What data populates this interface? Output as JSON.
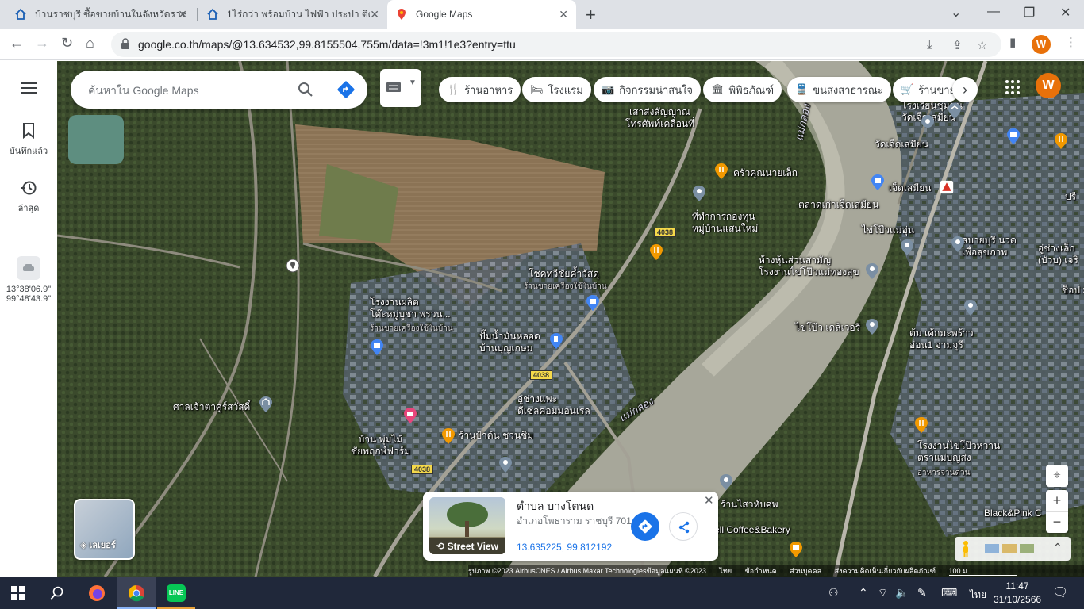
{
  "browser": {
    "tabs": [
      {
        "title": "บ้านราชบุรี ซื้อขายบ้านในจังหวัดราชบุรี",
        "active": false
      },
      {
        "title": "1ไร่กว่า พร้อมบ้าน ไฟฟ้า ประปา ติดถนน",
        "active": false
      },
      {
        "title": "Google Maps",
        "active": true
      }
    ],
    "url": "google.co.th/maps/@13.634532,99.8155504,755m/data=!3m1!1e3?entry=ttu",
    "profile_initial": "W"
  },
  "maps": {
    "search_placeholder": "ค้นหาใน Google Maps",
    "rail": {
      "saved": "บันทึกแล้ว",
      "recent": "ล่าสุด",
      "coord_line1": "13°38'06.9\"",
      "coord_line2": "99°48'43.9\""
    },
    "chips": [
      "ร้านอาหาร",
      "โรงแรม",
      "กิจกรรมน่าสนใจ",
      "พิพิธภัณฑ์",
      "ขนส่งสาธารณะ",
      "ร้านขาย"
    ],
    "account_initial": "W",
    "layers_label": "เลเยอร์",
    "labels": {
      "tower": "เสาส่งสัญญาณ\nโทรศัพท์เคลื่อนที่",
      "krua": "ครัวคุณนายเล็ก",
      "village_office": "ที่ทำการกองทุน\nหมู่บ้านแสนใหม่",
      "chok": "โชคทวีชัยค้ำวัสดุ",
      "chok_sub": "ร้านขายเครื่องใช้ในบ้าน",
      "table_factory": "โรงงานผลิต\nโต๊ะหมู่บูชา พรวน...",
      "table_sub": "ร้านขายเครื่องใช้ในบ้าน",
      "gas": "ปั๊มน้ำมันหลอด\nบ้านบุญเกษม",
      "garage": "อู่ช่างแพะ\nดีเซลคอมมอนเรล",
      "shrine": "ศาลเจ้าตาศูร์สวัสดิ์",
      "farm": "บ้าน พุ่มไม้\nชัยพฤกษ์ฟาร์ม",
      "pa_ton": "ร้านป้าต้น ชวนชิม",
      "river1": "แม่กลอง",
      "river2": "แม่กลอง",
      "school": "โรงเรียนชุมชน\nวัดเจ็ดเสมียน",
      "wat": "วัดเจ็ดเสมียน",
      "jed": "เจ็ดเสมียน",
      "market": "ตลาดเก่าเจ็ดเสมียน",
      "egg1": "ไข่โป๊วแม่อุ่น",
      "sabai": "สบายบุรี นวด\nเพื่อสุขภาพ",
      "shop_partner": "ห้างหุ้นส่วนสามัญ\nโรงงานไข่โป๊วแม่ทองสุข",
      "egg_delivery": "ไข่โป๊ว เดลิเวอรี่",
      "coconut": "ต้ม เค้กมะพร้าว\nอ่อน1 จามจุรี",
      "garage2": "อู่ช่างเล็ก\n(บัวบ) เจริ",
      "egg_factory": "โรงงานไข่โป๊วหวาน\nตราแม่บุญส่ง",
      "egg_factory_sub": "อาหารจานด่วน",
      "blackpink": "Black&Pink C",
      "coffee": "ell Coffee&Bakery",
      "sao": "ร้านไสวหับศพ",
      "rt": "ปรี",
      "shop_r": "อู่ช่",
      "chop": "ช็อป ม"
    },
    "road_shield": "4038",
    "place_card": {
      "name": "ตำบล บางโตนด",
      "address": "อำเภอโพธาราม ราชบุรี 701...",
      "coords": "13.635225, 99.812192",
      "street_view": "Street View"
    },
    "footer": [
      "รูปภาพ ©2023 AirbusCNES / Airbus.Maxar Technologiesข้อมูลแผนที่ ©2023",
      "ไทย",
      "ข้อกำหนด",
      "ส่วนบุคคล",
      "ส่งความคิดเห็นเกี่ยวกับผลิตภัณฑ์",
      "100 ม."
    ]
  },
  "taskbar": {
    "time": "11:47",
    "date": "31/10/2566",
    "lang": "ไทย"
  },
  "colors": {
    "maps_blue": "#1a73e8",
    "account_orange": "#e8710a",
    "taskbar": "#20283a"
  }
}
